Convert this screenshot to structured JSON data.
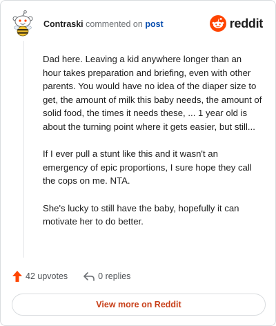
{
  "header": {
    "author": "Contraski",
    "action_text": "commented on",
    "post_link": "post",
    "brand_name": "reddit",
    "brand_color": "#ff4500"
  },
  "comment": {
    "paragraphs": [
      "Dad here. Leaving a kid anywhere longer than an hour takes preparation and briefing, even with other parents. You would have no idea of the diaper size to get, the amount of milk this baby needs, the amount of solid food, the times it needs these, ... 1 year old is about the turning point where it gets easier, but still...",
      "If I ever pull a stunt like this and it wasn't an emergency of epic proportions, I sure hope they call the cops on me. NTA.",
      "She's lucky to still have the baby, hopefully it can motivate her to do better."
    ]
  },
  "actions": {
    "upvotes_label": "42 upvotes",
    "replies_label": "0 replies",
    "upvote_icon": "upvote-arrow-icon",
    "reply_icon": "reply-arrow-icon",
    "upvote_color": "#ff4500"
  },
  "footer": {
    "view_more_label": "View more on Reddit",
    "view_more_color": "#c8401a"
  }
}
